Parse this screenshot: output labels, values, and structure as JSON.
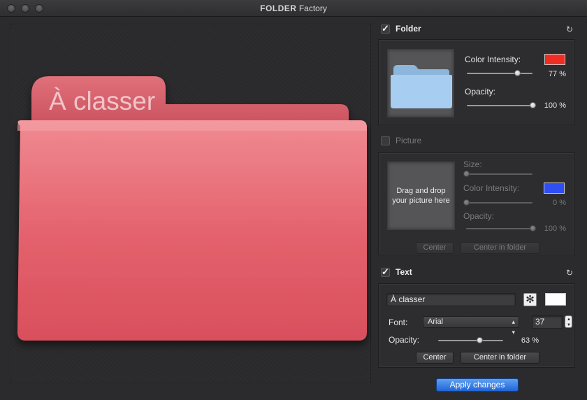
{
  "window": {
    "title_bold": "FOLDER",
    "title_rest": "Factory"
  },
  "preview": {
    "folder_label": "À classer",
    "folder_color": "#e05a66"
  },
  "folder_section": {
    "heading": "Folder",
    "checked": true,
    "color_intensity_label": "Color Intensity:",
    "color_intensity_value": "77 %",
    "color_intensity_fraction": 0.77,
    "color": "#ee2e24",
    "opacity_label": "Opacity:",
    "opacity_value": "100 %",
    "opacity_fraction": 1.0
  },
  "picture_section": {
    "heading": "Picture",
    "checked": false,
    "drop_hint": "Drag and drop your picture here",
    "size_label": "Size:",
    "size_fraction": 0.0,
    "color_intensity_label": "Color Intensity:",
    "color_intensity_value": "0 %",
    "color_intensity_fraction": 0.0,
    "color": "#2f4ff4",
    "opacity_label": "Opacity:",
    "opacity_value": "100 %",
    "opacity_fraction": 1.0,
    "center_label": "Center",
    "center_in_folder_label": "Center in folder"
  },
  "text_section": {
    "heading": "Text",
    "checked": true,
    "text_value": "À classer",
    "text_color": "#ffffff",
    "font_label": "Font:",
    "font_value": "Arial",
    "font_size": "37",
    "opacity_label": "Opacity:",
    "opacity_value": "63 %",
    "opacity_fraction": 0.63,
    "center_label": "Center",
    "center_in_folder_label": "Center in folder"
  },
  "apply_label": "Apply changes"
}
